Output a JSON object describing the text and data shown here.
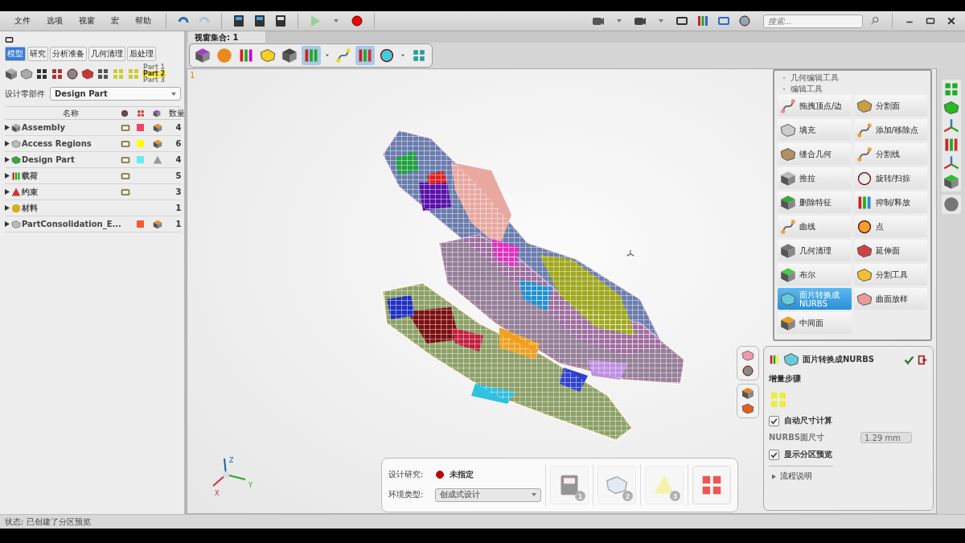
{
  "menu": [
    "文件",
    "选项",
    "视窗",
    "宏",
    "帮助"
  ],
  "search": {
    "placeholder": "搜索..."
  },
  "left_panel": {
    "tabs": [
      {
        "label": "模型",
        "selected": true
      },
      {
        "label": "研究",
        "selected": false
      },
      {
        "label": "分析准备",
        "selected": false
      },
      {
        "label": "几何清理",
        "selected": false
      },
      {
        "label": "后处理",
        "selected": false
      }
    ],
    "part_list": [
      "Part 1",
      "Part 2",
      "Part 3"
    ],
    "design_part": {
      "label": "设计零部件",
      "value": "Design Part"
    },
    "columns": {
      "name": "名称",
      "count": "数量"
    },
    "rows": [
      {
        "kind": "assembly",
        "name": "Assembly",
        "count": "4",
        "color": "#ee4466",
        "expanded": false
      },
      {
        "kind": "region",
        "name": "Access Regions",
        "count": "6",
        "color": "#ffff00",
        "expanded": false
      },
      {
        "kind": "design",
        "name": "Design Part",
        "count": "4",
        "color": "#66eeee",
        "expanded": false
      },
      {
        "kind": "load",
        "name": "载荷",
        "count": "5",
        "expanded": false
      },
      {
        "kind": "constraint",
        "name": "约束",
        "count": "3",
        "expanded": false
      },
      {
        "kind": "material",
        "name": "材料",
        "count": "1",
        "expanded": false
      },
      {
        "kind": "part",
        "name": "PartConsolidation_E...",
        "count": "1",
        "color": "#ff5533",
        "expanded": false
      }
    ]
  },
  "viewport": {
    "tab": "视窗集合: 1",
    "corner": "1",
    "axes": [
      "Z",
      "Y",
      "X"
    ]
  },
  "edit_tools": {
    "section": "几何编辑工具",
    "group": "编辑工具",
    "tools": [
      {
        "label": "拖拽顶点/边",
        "selected": false
      },
      {
        "label": "分割面",
        "selected": false
      },
      {
        "label": "填充",
        "selected": false
      },
      {
        "label": "添加/移除点",
        "selected": false
      },
      {
        "label": "缝合几何",
        "selected": false
      },
      {
        "label": "分割线",
        "selected": false
      },
      {
        "label": "推拉",
        "selected": false
      },
      {
        "label": "旋转/扫掠",
        "selected": false
      },
      {
        "label": "删除特征",
        "selected": false
      },
      {
        "label": "抑制/释放",
        "selected": false
      },
      {
        "label": "曲线",
        "selected": false
      },
      {
        "label": "点",
        "selected": false
      },
      {
        "label": "几何清理",
        "selected": false
      },
      {
        "label": "延伸面",
        "selected": false
      },
      {
        "label": "布尔",
        "selected": false
      },
      {
        "label": "分割工具",
        "selected": false
      },
      {
        "label": "面片转换成\nNURBS",
        "selected": true
      },
      {
        "label": "曲面放样",
        "selected": false
      },
      {
        "label": "中间面",
        "selected": false
      }
    ]
  },
  "nurbs_panel": {
    "title": "面片转换成NURBS",
    "step_label": "增量步骤",
    "auto_size": {
      "label": "自动尺寸计算",
      "checked": true
    },
    "size_field": {
      "label": "NURBS面尺寸",
      "value": "1.29 mm",
      "disabled": true
    },
    "preview": {
      "label": "显示分区预览",
      "checked": true
    },
    "help": "流程说明"
  },
  "study_bar": {
    "study_label": "设计研究:",
    "study_value": "未指定",
    "env_label": "环境类型:",
    "env_value": "创成式设计",
    "steps": [
      {
        "number": "1",
        "disabled": true
      },
      {
        "number": "2",
        "disabled": true
      },
      {
        "number": "3",
        "disabled": true
      }
    ]
  },
  "status_bar": {
    "label": "状态:",
    "text": "已创建了分区预览"
  }
}
